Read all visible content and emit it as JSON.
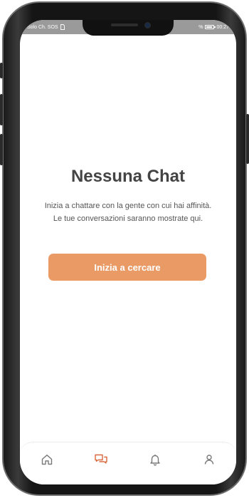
{
  "status_bar": {
    "carrier": "Solo Ch. SOS",
    "battery": "%",
    "time": "00:27"
  },
  "empty_state": {
    "title": "Nessuna Chat",
    "message": "Inizia a chattare con la gente con cui hai affinità. Le tue conversazioni saranno mostrate qui.",
    "button_label": "Inizia a cercare"
  },
  "tab_bar": {
    "tabs": [
      {
        "icon": "home-icon",
        "active": false
      },
      {
        "icon": "chat-icon",
        "active": true
      },
      {
        "icon": "bell-icon",
        "active": false
      },
      {
        "icon": "profile-icon",
        "active": false
      }
    ]
  },
  "colors": {
    "accent": "#ea9a64",
    "active_tab": "#d9683f",
    "inactive_tab": "#7a7a7a",
    "title_text": "#444444",
    "body_text": "#555555"
  }
}
